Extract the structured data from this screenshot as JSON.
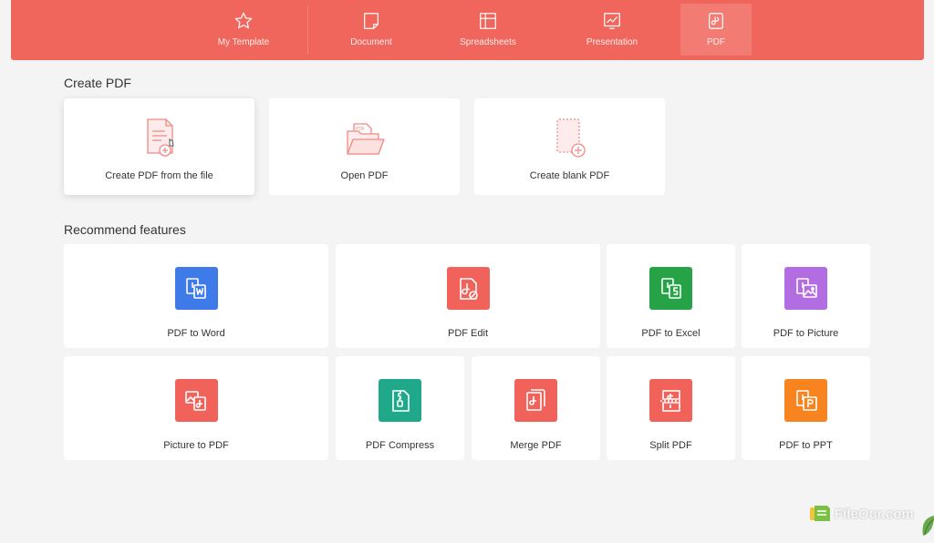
{
  "tabs": [
    {
      "label": "My Template",
      "icon": "star-icon",
      "active": false
    },
    {
      "label": "Document",
      "icon": "document-icon",
      "active": false
    },
    {
      "label": "Spreadsheets",
      "icon": "spreadsheet-icon",
      "active": false
    },
    {
      "label": "Presentation",
      "icon": "presentation-icon",
      "active": false
    },
    {
      "label": "PDF",
      "icon": "pdf-icon",
      "active": true
    }
  ],
  "create_section": {
    "title": "Create PDF",
    "items": [
      {
        "label": "Create PDF from the file",
        "icon": "pdf-from-file-icon"
      },
      {
        "label": "Open PDF",
        "icon": "open-pdf-folder-icon"
      },
      {
        "label": "Create blank PDF",
        "icon": "blank-pdf-icon"
      }
    ]
  },
  "recommend_section": {
    "title": "Recommend features",
    "items": [
      {
        "label": "PDF to Word",
        "icon": "pdf-to-word-icon",
        "color": "#3e7be8"
      },
      {
        "label": "PDF Edit",
        "icon": "pdf-edit-icon",
        "color": "#f0625a"
      },
      {
        "label": "PDF to Excel",
        "icon": "pdf-to-excel-icon",
        "color": "#27a347"
      },
      {
        "label": "PDF to Picture",
        "icon": "pdf-to-picture-icon",
        "color": "#b26de3"
      },
      {
        "label": "Picture to PDF",
        "icon": "picture-to-pdf-icon",
        "color": "#f0625a"
      },
      {
        "label": "PDF Compress",
        "icon": "pdf-compress-icon",
        "color": "#1fa88a"
      },
      {
        "label": "Merge PDF",
        "icon": "merge-pdf-icon",
        "color": "#f0625a"
      },
      {
        "label": "Split PDF",
        "icon": "split-pdf-icon",
        "color": "#f0625a"
      },
      {
        "label": "PDF to PPT",
        "icon": "pdf-to-ppt-icon",
        "color": "#f7841e"
      }
    ]
  },
  "watermark": {
    "text": "FileOur.com"
  }
}
